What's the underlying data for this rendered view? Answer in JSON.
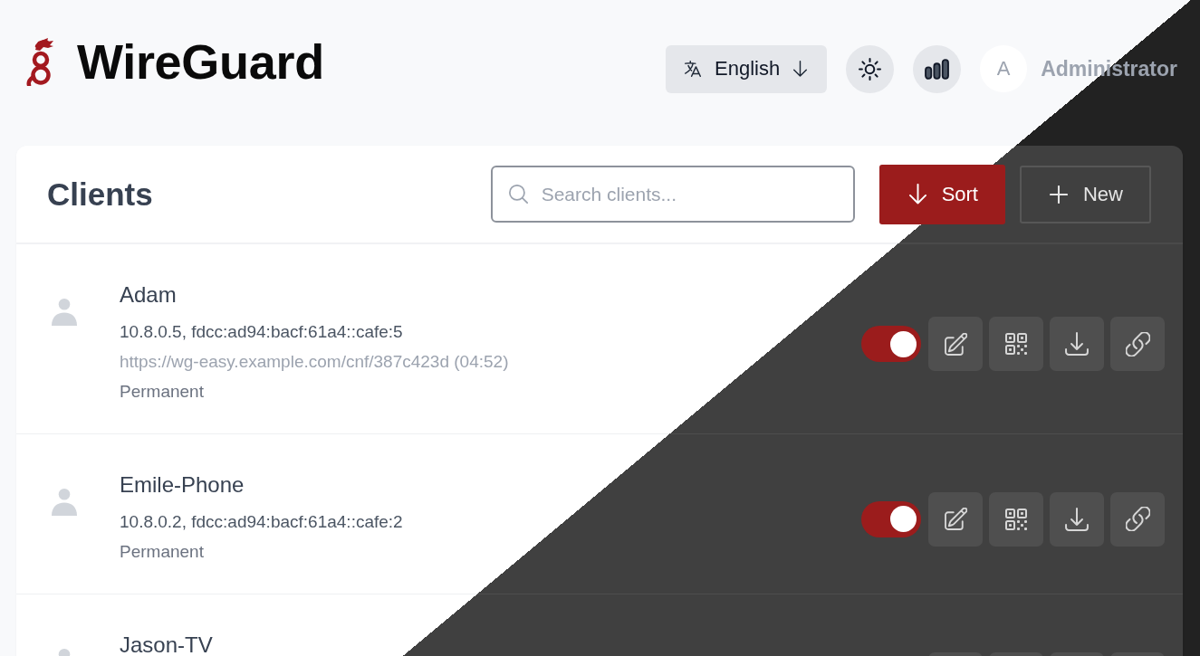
{
  "header": {
    "title": "WireGuard",
    "language": {
      "label": "English"
    },
    "user": {
      "initial": "A",
      "name": "Administrator"
    }
  },
  "clients_panel": {
    "title": "Clients",
    "search": {
      "placeholder": "Search clients..."
    },
    "buttons": [
      {
        "kind": "sort",
        "label": "Sort"
      },
      {
        "kind": "new",
        "label": "New"
      }
    ],
    "clients": [
      {
        "name": "Adam",
        "addresses": "10.8.0.5, fdcc:ad94:bacf:61a4::cafe:5",
        "link": "https://wg-easy.example.com/cnf/387c423d (04:52)",
        "expiry": "Permanent",
        "enabled": true
      },
      {
        "name": "Emile-Phone",
        "addresses": "10.8.0.2, fdcc:ad94:bacf:61a4::cafe:2",
        "expiry": "Permanent",
        "enabled": true
      },
      {
        "name": "Jason-TV"
      }
    ]
  }
}
